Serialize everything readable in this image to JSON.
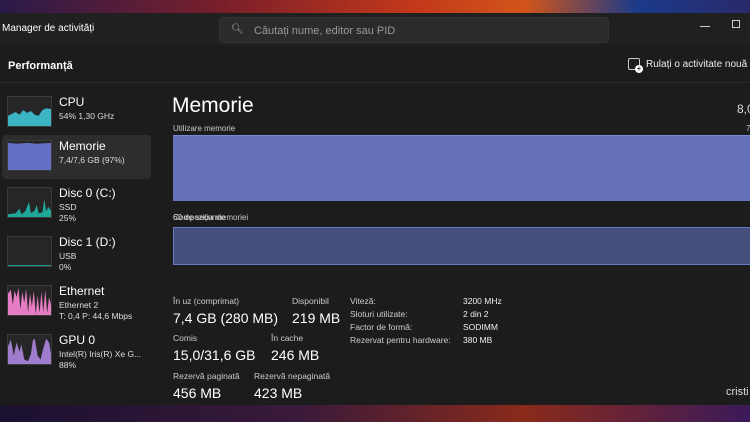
{
  "window": {
    "title": "Manager de activități",
    "search_placeholder": "Căutați nume, editor sau PID"
  },
  "header": {
    "title": "Performanță",
    "run_task": "Rulați o activitate nouă"
  },
  "sidebar": {
    "items": [
      {
        "name": "CPU",
        "line1": "54% 1,30 GHz",
        "color": "#3bb4c4"
      },
      {
        "name": "Memorie",
        "line1": "7,4/7,6 GB (97%)",
        "color": "#6470c8"
      },
      {
        "name": "Disc 0 (C:)",
        "line1": "SSD",
        "line2": "25%",
        "color": "#1fa89a"
      },
      {
        "name": "Disc 1 (D:)",
        "line1": "USB",
        "line2": "0%",
        "color": "#1fa89a"
      },
      {
        "name": "Ethernet",
        "line1": "Ethernet 2",
        "line2": "T: 0,4 P: 44,6 Mbps",
        "color": "#e87cc4"
      },
      {
        "name": "GPU 0",
        "line1": "Intel(R) Iris(R) Xe G...",
        "line2": "88%",
        "color": "#a07ccc"
      }
    ]
  },
  "main": {
    "title": "Memorie",
    "total": "8,0",
    "usage_label": "Utilizare memorie",
    "usage_max": "7",
    "time_label": "60 de secunde",
    "composition_label": "Compoziția memoriei",
    "stats": {
      "in_use_label": "În uz (comprimat)",
      "in_use": "7,4 GB (280 MB)",
      "available_label": "Disponibil",
      "available": "219 MB",
      "committed_label": "Comis",
      "committed": "15,0/31,6 GB",
      "cached_label": "În cache",
      "cached": "246 MB",
      "paged_label": "Rezervă paginată",
      "paged": "456 MB",
      "nonpaged_label": "Rezervă nepaginată",
      "nonpaged": "423 MB"
    },
    "details": [
      {
        "k": "Viteză:",
        "v": "3200 MHz"
      },
      {
        "k": "Sloturi utilizate:",
        "v": "2 din 2"
      },
      {
        "k": "Factor de formă:",
        "v": "SODIMM"
      },
      {
        "k": "Rezervat pentru hardware:",
        "v": "380 MB"
      }
    ]
  },
  "watermark": "cristi"
}
